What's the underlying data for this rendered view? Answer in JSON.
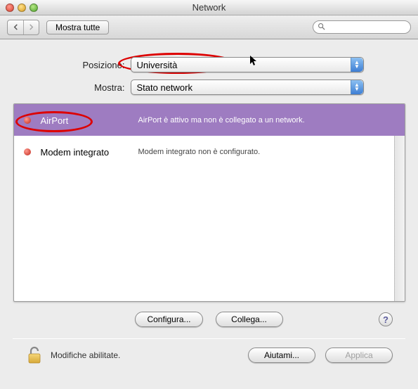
{
  "window": {
    "title": "Network"
  },
  "toolbar": {
    "show_all": "Mostra tutte",
    "search_placeholder": ""
  },
  "form": {
    "location_label": "Posizione:",
    "location_value": "Università",
    "show_label": "Mostra:",
    "show_value": "Stato network"
  },
  "interfaces": [
    {
      "name": "AirPort",
      "desc": "AirPort è attivo ma non è collegato a un network.",
      "selected": true
    },
    {
      "name": "Modem integrato",
      "desc": "Modem integrato non è configurato.",
      "selected": false
    }
  ],
  "actions": {
    "configure": "Configura...",
    "connect": "Collega...",
    "help": "?"
  },
  "footer": {
    "status": "Modifiche abilitate.",
    "help_me": "Aiutami...",
    "apply": "Applica"
  }
}
